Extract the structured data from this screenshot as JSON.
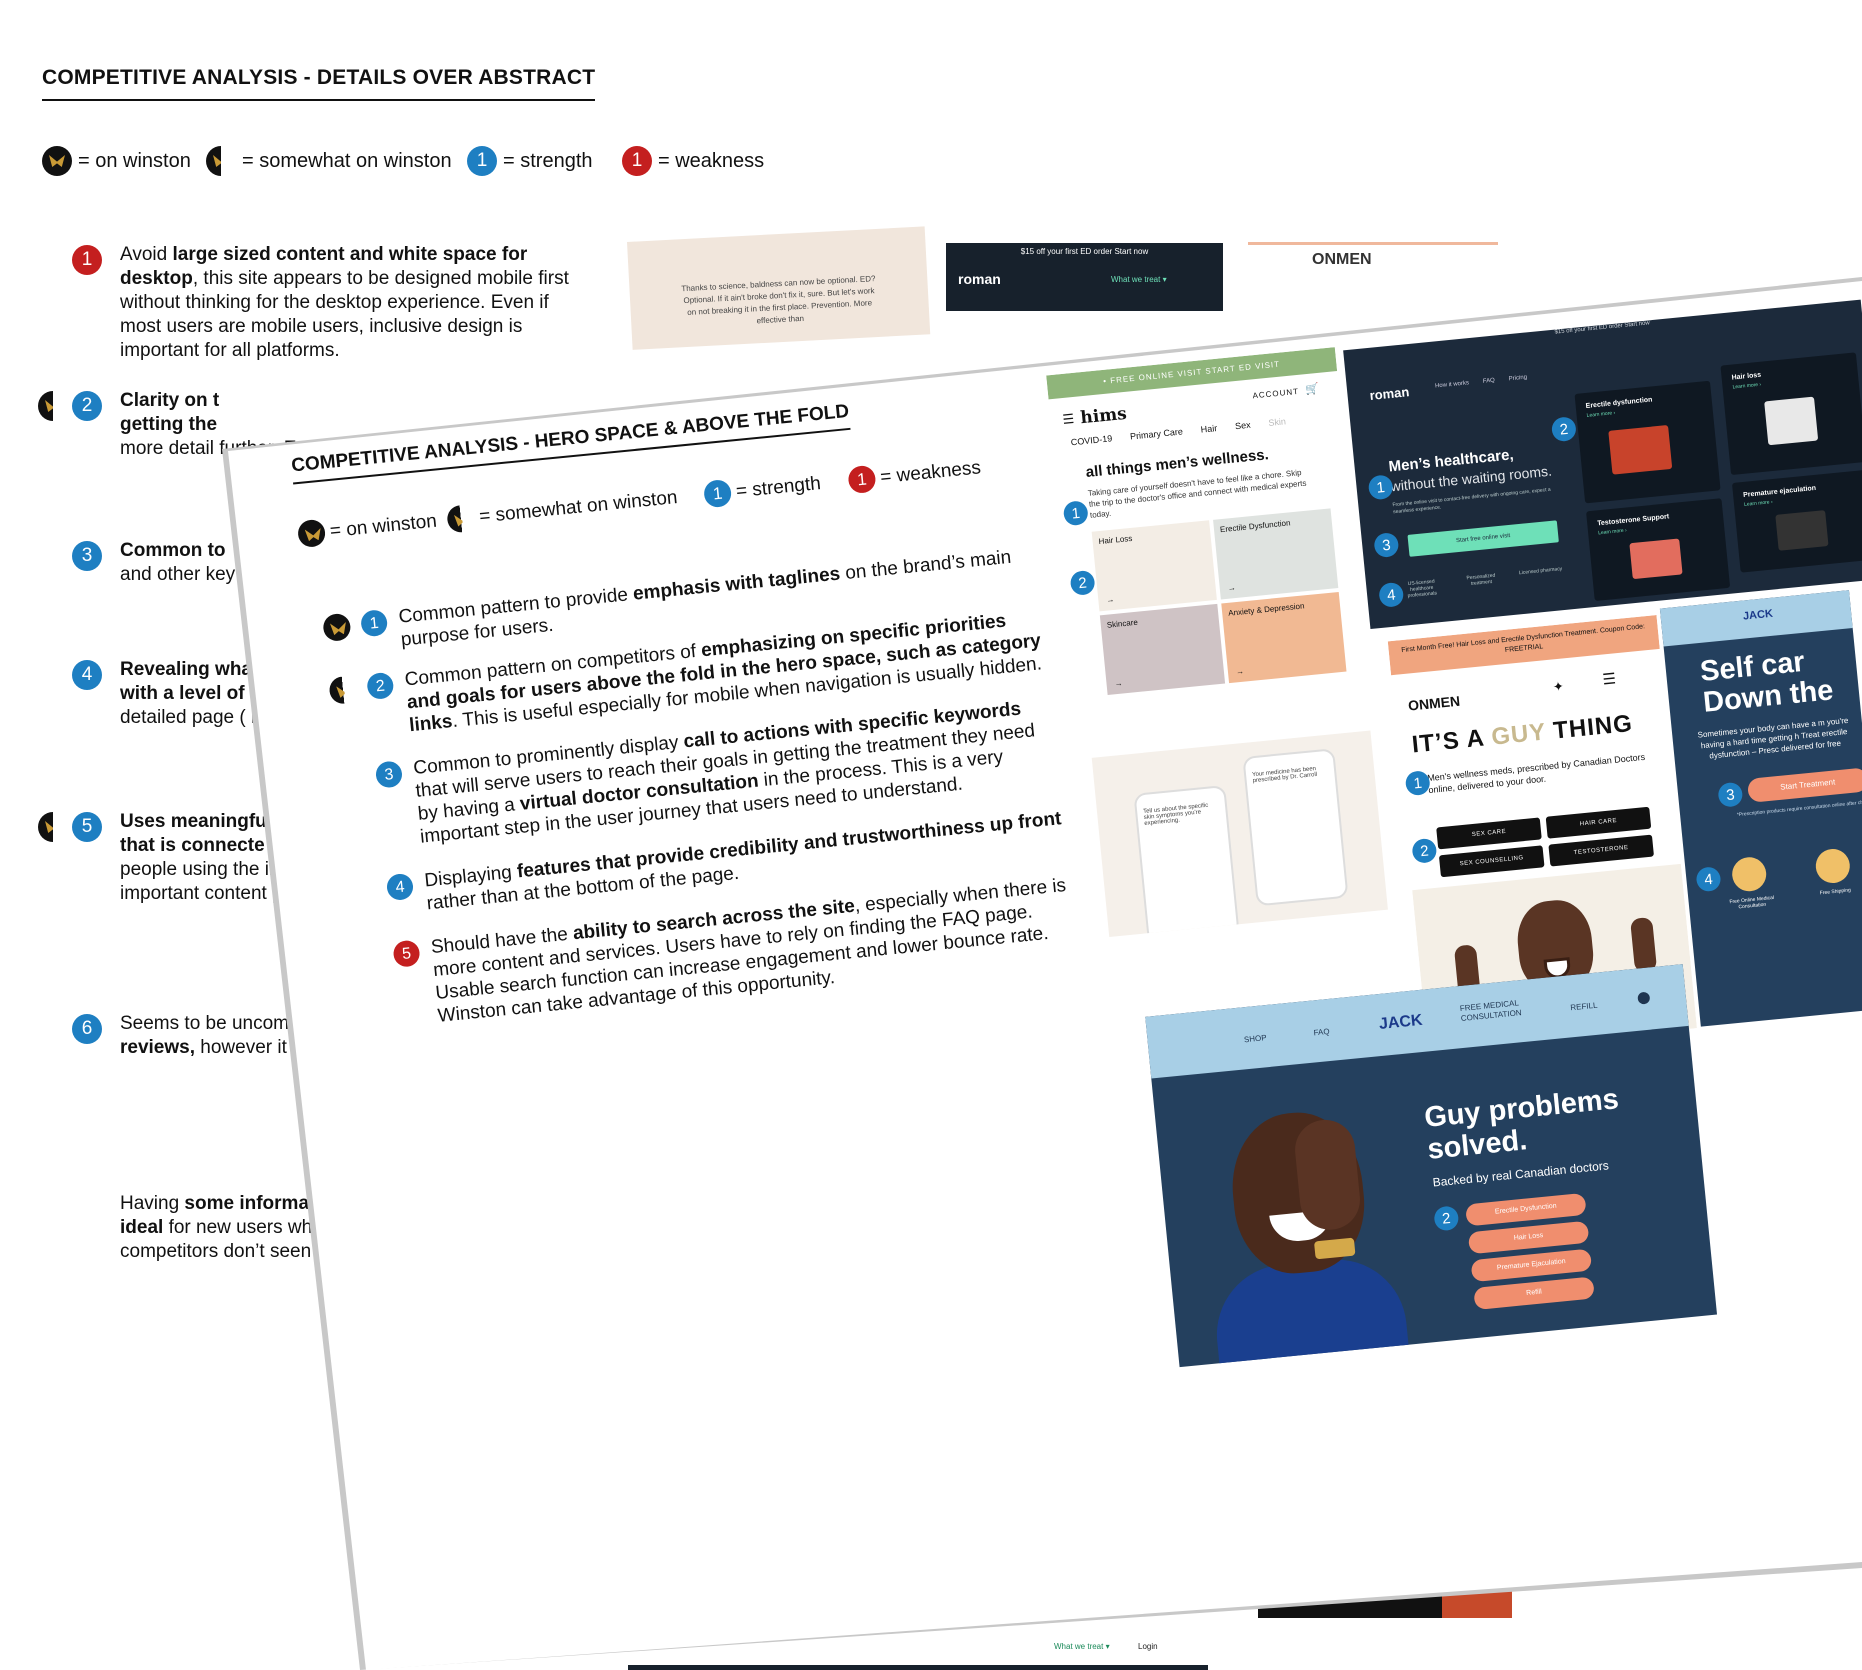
{
  "back": {
    "title": "COMPETITIVE ANALYSIS - DETAILS OVER ABSTRACT",
    "legend": {
      "on_winston": "= on winston",
      "somewhat_on_winston": "= somewhat on winston",
      "strength": "= strength",
      "weakness": "= weakness",
      "strength_num": "1",
      "weakness_num": "1"
    },
    "items": [
      {
        "num": "1",
        "color": "#c41f1f",
        "bold": "Avoid ",
        "b1": "large sized content and white space for desktop",
        "rest": ", this site appears to be designed mobile first without thinking for the desktop experience. Even if most users are mobile users, inclusive design is important for all platforms."
      },
      {
        "num": "2",
        "color": "#1e7fc2",
        "b1": "Clarity on t",
        "b2": "getting the",
        "rest": "more detail further.  Eye leave the us"
      },
      {
        "num": "3",
        "color": "#1e7fc2",
        "b1": "Common to",
        "rest": "and other key brand’s credi more about th"
      },
      {
        "num": "4",
        "color": "#1e7fc2",
        "b1": "Revealing wha",
        "b2": "with a level of",
        "rest": "detailed page ( make the exper users to explore"
      },
      {
        "num": "5",
        "color": "#1e7fc2",
        "b1": "Uses meaningfu",
        "b2": "that is connecte",
        "rest": "people using the imagery/graphic. nngroup, these ty important content photos of models t"
      },
      {
        "num": "6",
        "color": "#1e7fc2",
        "t1": "Seems to be uncom",
        "b1": "reviews,",
        "rest": " however it further. Winston ca opportunity."
      }
    ],
    "closing": {
      "t1": "Having ",
      "b1": "some informat",
      "b2": "ideal",
      "rest": " for new users wh industry and brand. Als competitors don’t seen ink to an About Us pag"
    },
    "thumb_beige_text": "Thanks to science, baldness can now be optional. ED? Optional. If it ain't broke don't fix it, sure. But let's work on not breaking it in the first place. Prevention. More effective than",
    "thumb_roman_promo": "$15 off your first ED order Start now",
    "thumb_roman_logo": "roman",
    "thumb_roman_menu": "What we treat ▾",
    "thumb_onmen_logo": "ONMEN",
    "thumb_nav_1": "What we treat ▾",
    "thumb_nav_2": "Login"
  },
  "front": {
    "title": "COMPETITIVE ANALYSIS - HERO SPACE & ABOVE THE FOLD",
    "legend": {
      "on_winston": "= on winston",
      "somewhat_on_winston": "= somewhat on winston",
      "strength": "= strength",
      "weakness": "= weakness",
      "strength_num": "1",
      "weakness_num": "1"
    },
    "items": [
      {
        "num": "1",
        "t1": "Common pattern to provide ",
        "b1": "emphasis with taglines",
        "rest": " on the brand’s main purpose for users."
      },
      {
        "num": "2",
        "t1": "Common pattern on competitors of ",
        "b1": "emphasizing on specific priorities and goals for users above the fold in the hero space, such as category links",
        "rest": ". This is useful especially for mobile when navigation is usually hidden."
      },
      {
        "num": "3",
        "t1": "Common to prominently display ",
        "b1": "call to actions with specific keywords",
        "rest1": " that will serve users to reach their goals in getting the treatment they need by having a ",
        "b2": "virtual doctor consultation",
        "rest": " in the process. This is a very important step in the user journey that users need to understand."
      },
      {
        "num": "4",
        "t1": "Displaying ",
        "b1": "features that provide credibility and trustworthiness up front",
        "rest": " rather than at the bottom of the page."
      },
      {
        "num": "5",
        "t1": "Should have the ",
        "b1": "ability to search across the site",
        "rest": ", especially when there is more content and services. Users have to rely on finding the FAQ page. Usable search function can increase engagement and lower bounce rate. Winston can take advantage of this opportunity."
      }
    ],
    "hims": {
      "banner": "• FREE ONLINE VISIT  START ED VISIT",
      "logo": "hims",
      "account": "ACCOUNT",
      "tabs": [
        "COVID-19",
        "Primary Care",
        "Hair",
        "Sex",
        "Skin"
      ],
      "headline": "all things men’s wellness.",
      "sub": "Taking care of yourself doesn't have to feel like a chore. Skip the trip to the doctor's office and connect with medical experts today.",
      "tiles": [
        "Hair Loss",
        "Erectile Dysfunction",
        "Skincare",
        "Anxiety & Depression"
      ],
      "phone1": "Tell us about the specific skin symptoms you're experiencing.",
      "phone2": "Your medicine has been prescribed by Dr. Carroll"
    },
    "roman": {
      "promo": "$15 off your first ED order Start now",
      "logo": "roman",
      "nav": [
        "How it works",
        "FAQ",
        "Pricing"
      ],
      "headline": "Men’s healthcare,",
      "headline2": "without the waiting rooms.",
      "desc": "From the online visit to contact-free delivery with ongoing care, expect a seamless experience.",
      "cta": "Start free online visit",
      "features": [
        "US-licensed healthcare professionals",
        "Personalized treatment",
        "Licensed pharmacy"
      ],
      "cards": [
        {
          "title": "Erectile dysfunction",
          "link": "Learn more  ›"
        },
        {
          "title": "Hair loss",
          "link": "Learn more  ›"
        },
        {
          "title": "Testosterone Support",
          "link": "Learn more  ›"
        },
        {
          "title": "Premature ejaculation",
          "link": "Learn more  ›"
        }
      ]
    },
    "onmen": {
      "bar": "First Month Free! Hair Loss and Erectile Dysfunction Treatment. Coupon Code: FREETRIAL",
      "logo": "ONMEN",
      "big_1": "IT’S A ",
      "big_2": "GUY",
      "big_3": " THING",
      "sub": "Men's wellness meds, prescribed by Canadian Doctors online, delivered to your door.",
      "buttons": [
        "SEX CARE",
        "HAIR CARE",
        "SEX COUNSELLING",
        "TESTOSTERONE"
      ]
    },
    "jack_mobile": {
      "logo": "JACK",
      "big": "Self car\nDown the",
      "sub": "Sometimes your body can have a m you're having a hard time getting h Treat erectile dysfunction – Presc delivered for free",
      "cta": "Start Treatment",
      "fine": "*Prescription products require consultation online after ch",
      "icons": [
        "Free Online Medical Consultation",
        "Free Shipping"
      ]
    },
    "jack_desktop": {
      "nav": [
        "SHOP",
        "FAQ",
        "FREE MEDICAL CONSULTATION",
        "REFILL"
      ],
      "logo": "JACK",
      "headline": "Guy problems solved.",
      "sub": "Backed by real Canadian doctors",
      "pills": [
        "Erectile Dysfunction",
        "Hair Loss",
        "Premature Ejaculation",
        "Refill"
      ]
    },
    "pins": {
      "p1": "1",
      "p2": "2",
      "p3": "3",
      "p4": "4"
    }
  }
}
